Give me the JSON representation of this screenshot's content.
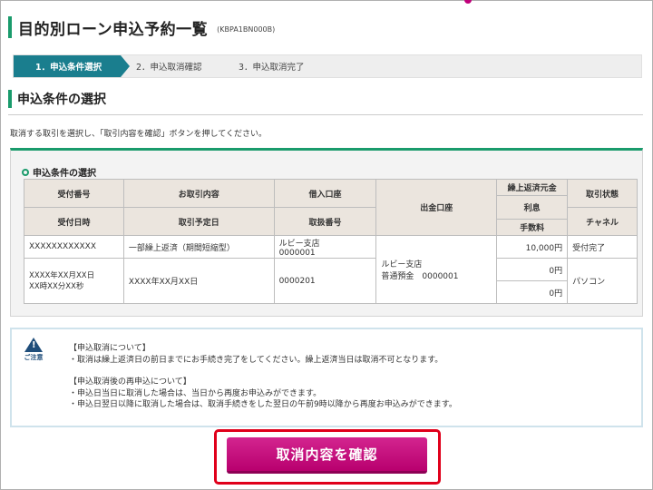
{
  "page": {
    "title": "目的別ローン申込予約一覧",
    "screen_id": "(KBPA1BN000B)"
  },
  "steps": [
    {
      "label": "1．申込条件選択"
    },
    {
      "label": "2．申込取消確認"
    },
    {
      "label": "3．申込取消完了"
    }
  ],
  "section": {
    "title": "申込条件の選択",
    "instruction": "取消する取引を選択し、「取引内容を確認」ボタンを押してください。"
  },
  "panel": {
    "title": "申込条件の選択",
    "headers": {
      "uketsuke_bango": "受付番号",
      "otorihiki_naiyo": "お取引内容",
      "kariire_koza": "借入口座",
      "shukkin_koza": "出金口座",
      "kurijo_hensai_gankin": "繰上返済元金",
      "torihiki_jotai": "取引状態",
      "uketsuke_nichiji": "受付日時",
      "torihiki_yoteibi": "取引予定日",
      "toriatsukai_bango": "取扱番号",
      "risoku": "利息",
      "channel": "チャネル",
      "tesuryo": "手数料"
    },
    "row": {
      "receipt_number": "XXXXXXXXXXXX",
      "transaction_content": "一部繰上返済（期間短縮型）",
      "loan_branch": "ルビー支店",
      "loan_number": "0000001",
      "withdraw_branch": "ルビー支店",
      "withdraw_account": "普通預金　0000001",
      "principal": "10,000円",
      "status": "受付完了",
      "interest": "0円",
      "receipt_datetime_1": "XXXX年XX月XX日",
      "receipt_datetime_2": "XX時XX分XX秒",
      "scheduled_date": "XXXX年XX月XX日",
      "handling_number": "0000201",
      "fee": "0円",
      "channel": "パソコン"
    }
  },
  "notice": {
    "icon_label": "ご注意",
    "lines": [
      "【申込取消について】",
      "・取消は繰上返済日の前日までにお手続き完了をしてください。繰上返済当日は取消不可となります。",
      "【申込取消後の再申込について】",
      "・申込日当日に取消した場合は、当日から再度お申込みができます。",
      "・申込日翌日以降に取消した場合は、取消手続きをした翌日の午前9時以降から再度お申込みができます。"
    ]
  },
  "confirm_button": {
    "label": "取消内容を確認"
  },
  "colors": {
    "accent_green": "#1a9b6c",
    "step_active": "#1a7e8e",
    "button_magenta": "#c4137f",
    "highlight_red": "#e0001b"
  }
}
